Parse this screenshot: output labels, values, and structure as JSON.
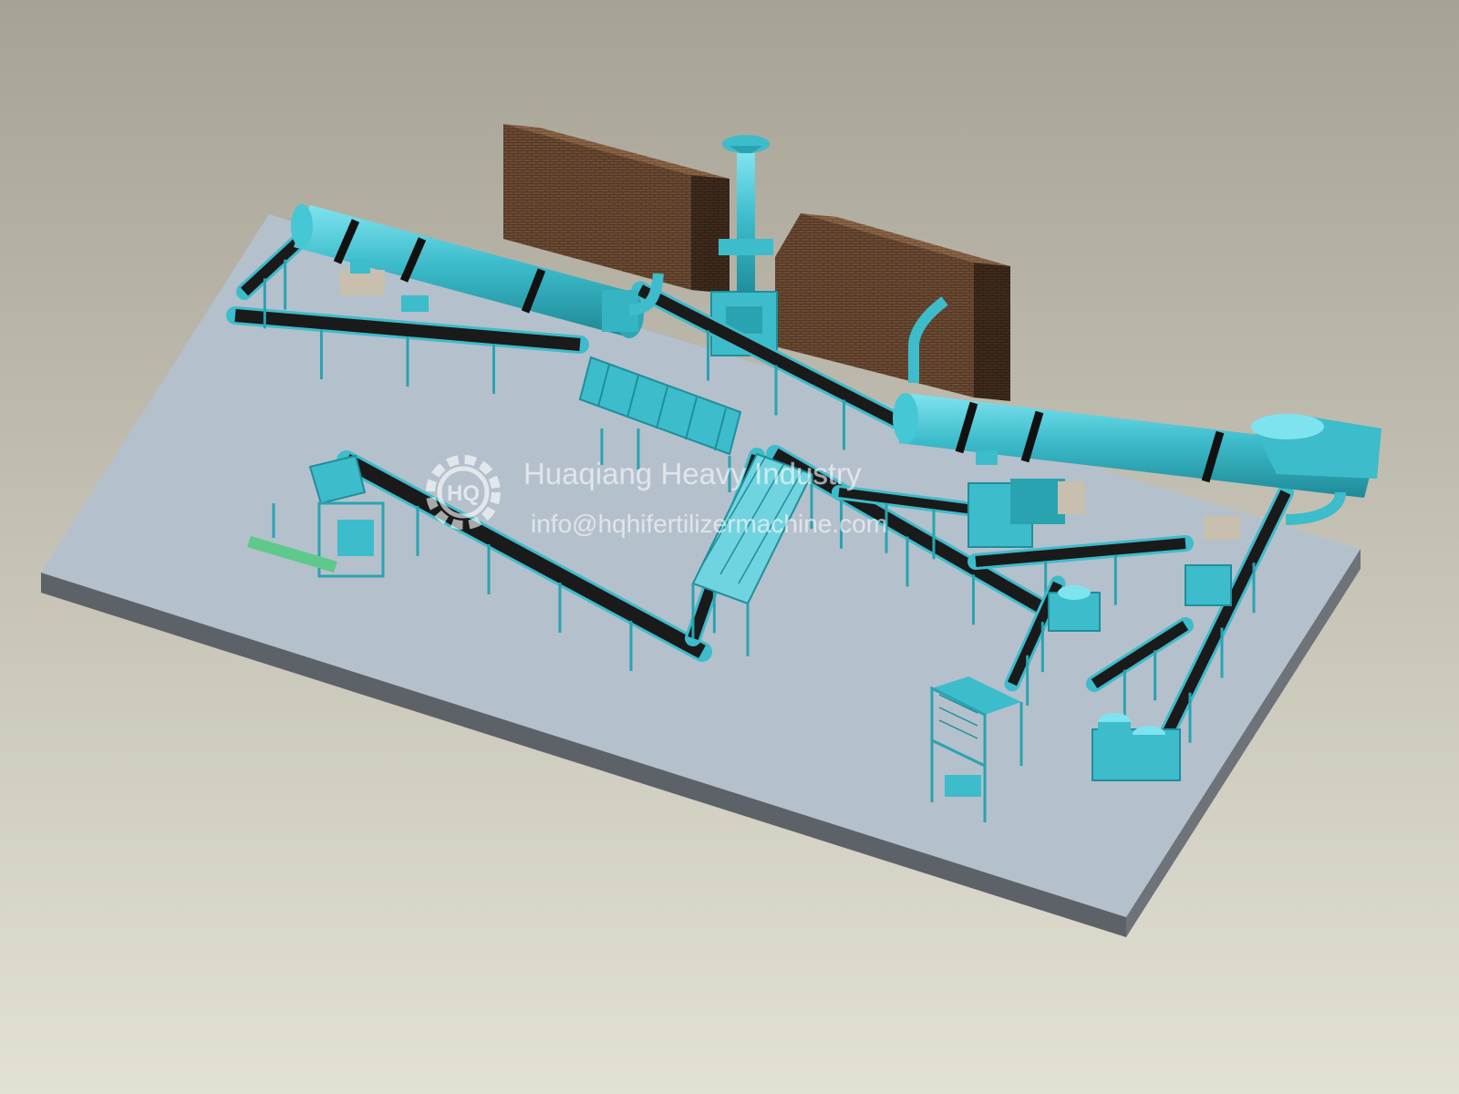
{
  "watermark": {
    "company": "Huaqiang Heavy Industry",
    "email": "info@hqhifertilizermachine.com",
    "logo_letters": "HQ"
  },
  "colors": {
    "background_top": "#a7a497",
    "background_bottom": "#e2dfd3",
    "platform_top": "#b4c0cc",
    "platform_front": "#5d6268",
    "platform_side": "#6d7278",
    "equipment": "#3dbccb",
    "equipment_dark": "#1f8f9c",
    "belt": "#1a1a1a",
    "brick": "#6b4a32",
    "brick_dark": "#3e2a1c",
    "watermark": "#ffffff"
  }
}
